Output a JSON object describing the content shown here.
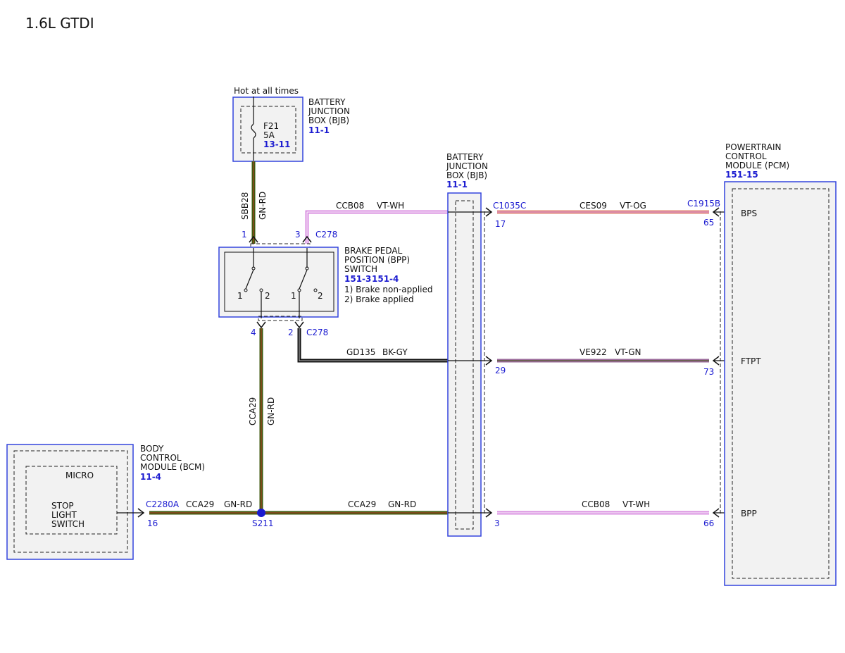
{
  "title": "1.6L GTDI",
  "colors": {
    "box_border": "#3344dd",
    "box_fill": "#f2f2f2",
    "link_blue": "#1a1ad0",
    "gn_rd_main": "#3d5a0e",
    "gn_rd_stripe": "#c0392b",
    "vt_wh": "#d98ee0",
    "vt_og": "#e08a7a",
    "vt_gn": "#9a6a9a",
    "bk_gy": "#111111"
  },
  "bjb_top": {
    "hot_label": "Hot at all times",
    "name_lines": [
      "BATTERY",
      "JUNCTION",
      "BOX (BJB)"
    ],
    "ref": "11-1",
    "fuse_name": "F21",
    "fuse_rating": "5A",
    "fuse_ref": "13-11"
  },
  "wire_sbb28": {
    "circuit": "SBB28",
    "color": "GN-RD"
  },
  "wire_ccb08_top": {
    "circuit": "CCB08",
    "color": "VT-WH"
  },
  "bpp_switch": {
    "name_lines": [
      "BRAKE PEDAL",
      "POSITION (BPP)",
      "SWITCH"
    ],
    "ref_a": "151-3",
    "ref_b": "151-4",
    "note_1": "1) Brake non-applied",
    "note_2": "2) Brake applied",
    "pin_top_left": "1",
    "pin_top_right": "3",
    "connector_top": "C278",
    "pin_bottom_left": "4",
    "pin_bottom_right": "2",
    "connector_bottom": "C278",
    "sw1_pos1": "1",
    "sw1_pos2": "2",
    "sw2_pos1": "1",
    "sw2_pos2": "2"
  },
  "wire_gd135": {
    "circuit": "GD135",
    "color": "BK-GY"
  },
  "wire_cca29_vertical": {
    "circuit": "CCA29",
    "color": "GN-RD"
  },
  "bcm": {
    "name_lines": [
      "BODY",
      "CONTROL",
      "MODULE (BCM)"
    ],
    "ref": "11-4",
    "micro_label": "MICRO",
    "switch_lines": [
      "STOP",
      "LIGHT",
      "SWITCH"
    ],
    "connector": "C2280A",
    "pin": "16"
  },
  "wire_cca29_left": {
    "circuit": "CCA29",
    "color": "GN-RD"
  },
  "splice": "S211",
  "wire_cca29_right": {
    "circuit": "CCA29",
    "color": "GN-RD"
  },
  "bjb_mid": {
    "name_lines": [
      "BATTERY",
      "JUNCTION",
      "BOX (BJB)"
    ],
    "ref": "11-1",
    "connector": "C1035C",
    "pin_17": "17",
    "pin_29": "29",
    "pin_3": "3"
  },
  "wire_ces09": {
    "circuit": "CES09",
    "color": "VT-OG"
  },
  "wire_ve922": {
    "circuit": "VE922",
    "color": "VT-GN"
  },
  "wire_ccb08_bottom": {
    "circuit": "CCB08",
    "color": "VT-WH"
  },
  "pcm": {
    "name_lines": [
      "POWERTRAIN",
      "CONTROL",
      "MODULE (PCM)"
    ],
    "ref": "151-15",
    "connector": "C1915B",
    "pin_65": "65",
    "pin_73": "73",
    "pin_66": "66",
    "sig_bps": "BPS",
    "sig_ftpt": "FTPT",
    "sig_bpp": "BPP"
  }
}
